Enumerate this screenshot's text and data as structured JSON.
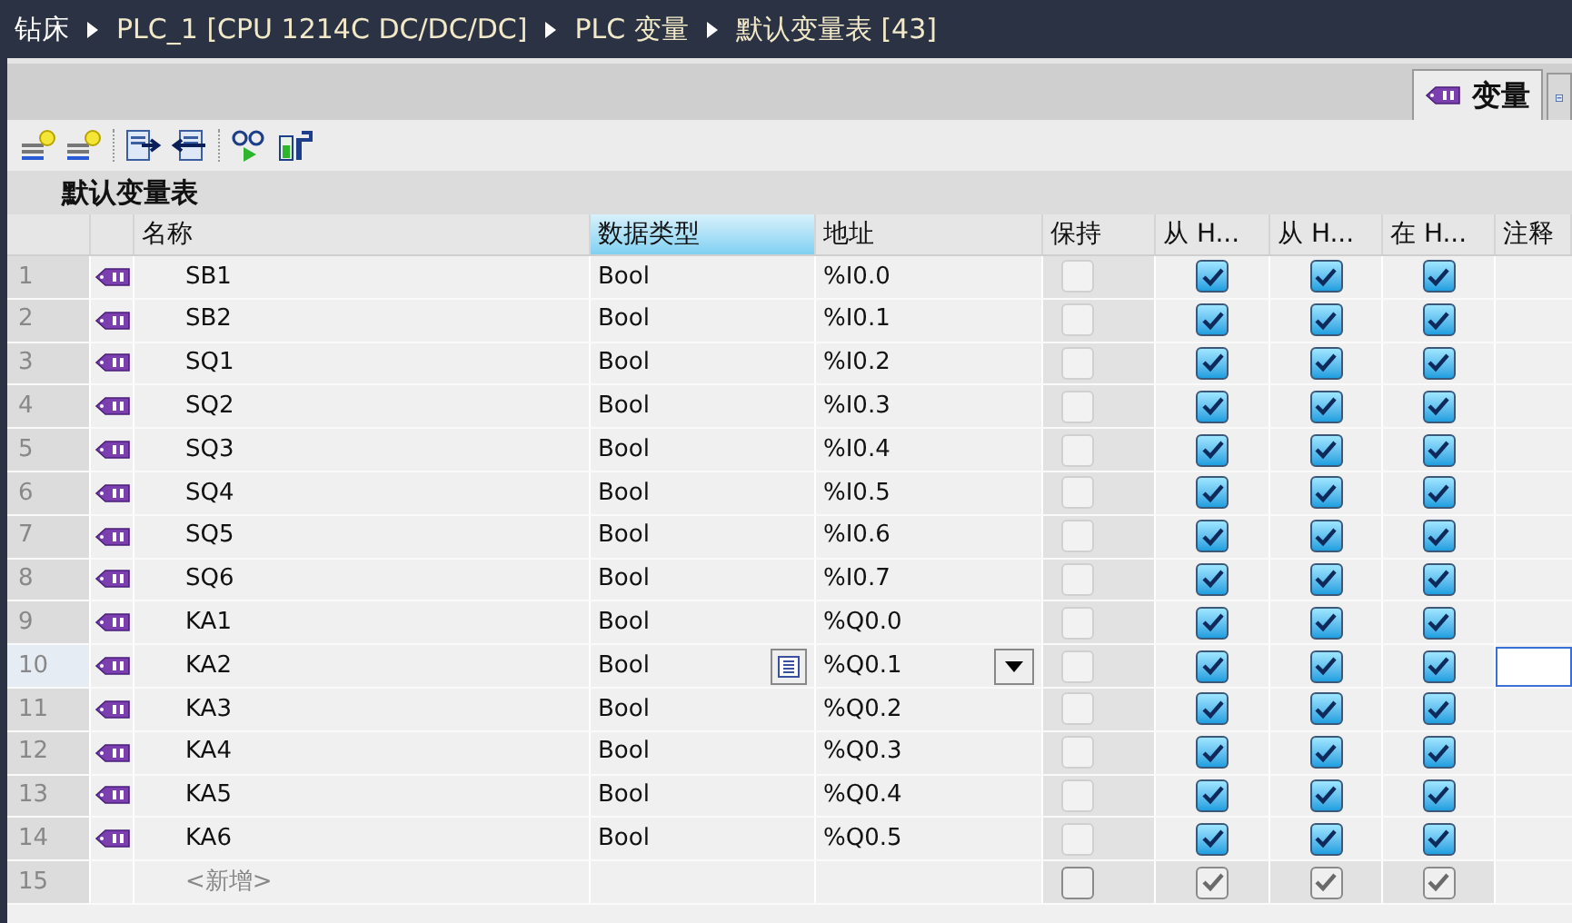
{
  "breadcrumb": [
    {
      "label": "钻床"
    },
    {
      "label": "PLC_1 [CPU 1214C DC/DC/DC]"
    },
    {
      "label": "PLC 变量"
    },
    {
      "label": "默认变量表 [43]"
    }
  ],
  "tabs": [
    {
      "label": "变量",
      "selected": true
    },
    {
      "selected": false
    }
  ],
  "table_title": "默认变量表",
  "columns": [
    {
      "label": "名称",
      "selected": false
    },
    {
      "label": "数据类型",
      "selected": true
    },
    {
      "label": "地址",
      "selected": false
    },
    {
      "label": "保持",
      "selected": false
    },
    {
      "label": "从 H...",
      "selected": false
    },
    {
      "label": "从 H...",
      "selected": false
    },
    {
      "label": "在 H...",
      "selected": false
    },
    {
      "label": "注释",
      "selected": false
    }
  ],
  "rows": [
    {
      "kind": "variable",
      "number": "1",
      "name": "SB1",
      "data_type": "Bool",
      "address": "%I0.0",
      "retain": false,
      "h1": true,
      "h2": true,
      "h3": true,
      "selected": false
    },
    {
      "kind": "variable",
      "number": "2",
      "name": "SB2",
      "data_type": "Bool",
      "address": "%I0.1",
      "retain": false,
      "h1": true,
      "h2": true,
      "h3": true,
      "selected": false
    },
    {
      "kind": "variable",
      "number": "3",
      "name": "SQ1",
      "data_type": "Bool",
      "address": "%I0.2",
      "retain": false,
      "h1": true,
      "h2": true,
      "h3": true,
      "selected": false
    },
    {
      "kind": "variable",
      "number": "4",
      "name": "SQ2",
      "data_type": "Bool",
      "address": "%I0.3",
      "retain": false,
      "h1": true,
      "h2": true,
      "h3": true,
      "selected": false
    },
    {
      "kind": "variable",
      "number": "5",
      "name": "SQ3",
      "data_type": "Bool",
      "address": "%I0.4",
      "retain": false,
      "h1": true,
      "h2": true,
      "h3": true,
      "selected": false
    },
    {
      "kind": "variable",
      "number": "6",
      "name": "SQ4",
      "data_type": "Bool",
      "address": "%I0.5",
      "retain": false,
      "h1": true,
      "h2": true,
      "h3": true,
      "selected": false
    },
    {
      "kind": "variable",
      "number": "7",
      "name": "SQ5",
      "data_type": "Bool",
      "address": "%I0.6",
      "retain": false,
      "h1": true,
      "h2": true,
      "h3": true,
      "selected": false
    },
    {
      "kind": "variable",
      "number": "8",
      "name": "SQ6",
      "data_type": "Bool",
      "address": "%I0.7",
      "retain": false,
      "h1": true,
      "h2": true,
      "h3": true,
      "selected": false
    },
    {
      "kind": "variable",
      "number": "9",
      "name": "KA1",
      "data_type": "Bool",
      "address": "%Q0.0",
      "retain": false,
      "h1": true,
      "h2": true,
      "h3": true,
      "selected": false
    },
    {
      "kind": "variable",
      "number": "10",
      "name": "KA2",
      "data_type": "Bool",
      "address": "%Q0.1",
      "retain": false,
      "h1": true,
      "h2": true,
      "h3": true,
      "selected": true
    },
    {
      "kind": "variable",
      "number": "11",
      "name": "KA3",
      "data_type": "Bool",
      "address": "%Q0.2",
      "retain": false,
      "h1": true,
      "h2": true,
      "h3": true,
      "selected": false
    },
    {
      "kind": "variable",
      "number": "12",
      "name": "KA4",
      "data_type": "Bool",
      "address": "%Q0.3",
      "retain": false,
      "h1": true,
      "h2": true,
      "h3": true,
      "selected": false
    },
    {
      "kind": "variable",
      "number": "13",
      "name": "KA5",
      "data_type": "Bool",
      "address": "%Q0.4",
      "retain": false,
      "h1": true,
      "h2": true,
      "h3": true,
      "selected": false
    },
    {
      "kind": "variable",
      "number": "14",
      "name": "KA6",
      "data_type": "Bool",
      "address": "%Q0.5",
      "retain": false,
      "h1": true,
      "h2": true,
      "h3": true,
      "selected": false
    },
    {
      "kind": "new",
      "number": "15",
      "name": "<新增>",
      "retain": false,
      "h1": true,
      "h2": true,
      "h3": true,
      "selected": false
    }
  ]
}
